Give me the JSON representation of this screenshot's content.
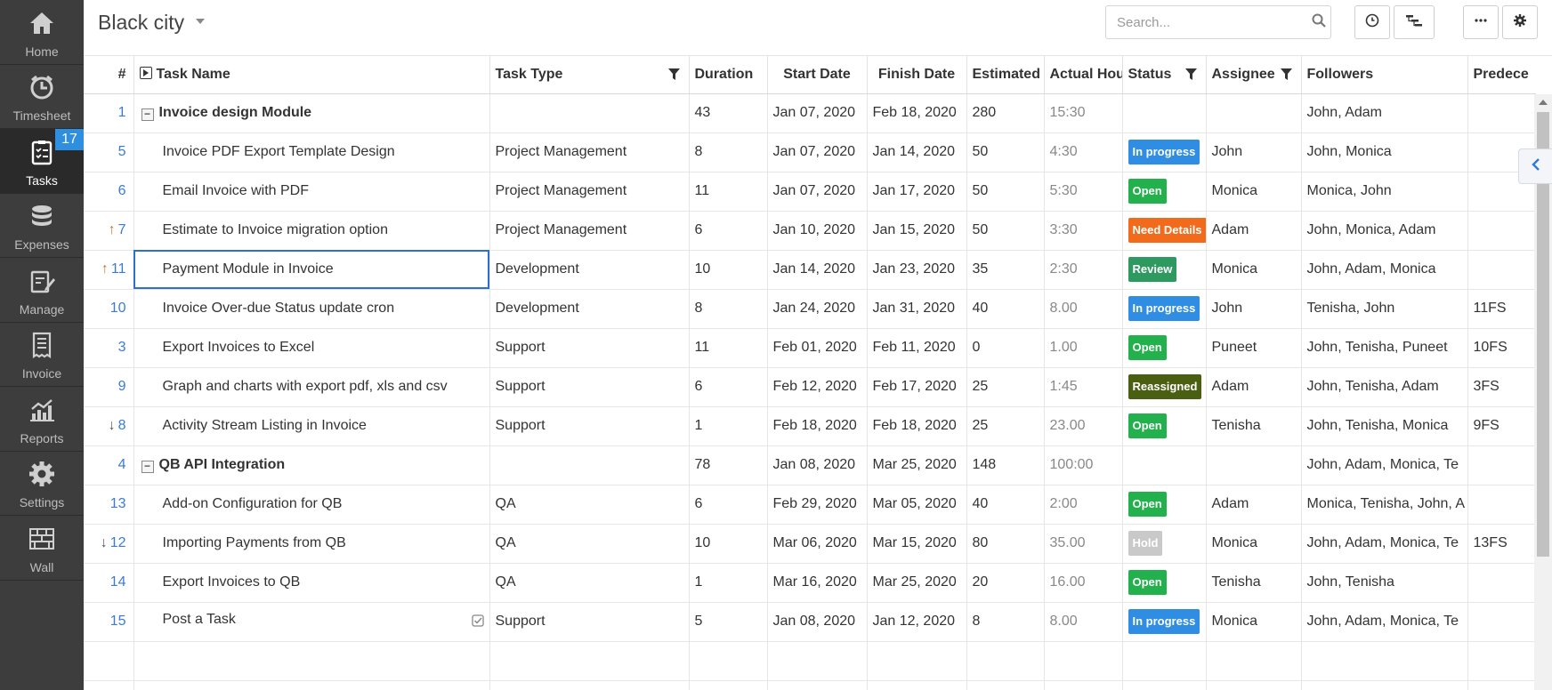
{
  "app": {
    "project_name": "Black city"
  },
  "sidebar": {
    "items": [
      {
        "label": "Home",
        "icon": "home-icon"
      },
      {
        "label": "Timesheet",
        "icon": "clock-icon"
      },
      {
        "label": "Tasks",
        "icon": "tasks-icon",
        "badge": "17",
        "active": true
      },
      {
        "label": "Expenses",
        "icon": "coins-icon"
      },
      {
        "label": "Manage",
        "icon": "manage-icon"
      },
      {
        "label": "Invoice",
        "icon": "invoice-icon"
      },
      {
        "label": "Reports",
        "icon": "chart-icon"
      },
      {
        "label": "Settings",
        "icon": "gear-icon"
      },
      {
        "label": "Wall",
        "icon": "wall-icon"
      }
    ]
  },
  "toolbar": {
    "search_placeholder": "Search...",
    "buttons": [
      "clock-icon",
      "hierarchy-icon",
      "more-icon",
      "gear-icon"
    ]
  },
  "grid": {
    "columns": [
      "#",
      "Task Name",
      "Task Type",
      "Duration",
      "Start Date",
      "Finish Date",
      "Estimated",
      "Actual Hou",
      "Status",
      "Assignee",
      "Followers",
      "Predece"
    ],
    "rows": [
      {
        "id": "1",
        "arrow": "",
        "task": "Invoice design Module",
        "group": true,
        "type": "",
        "duration": "43",
        "start": "Jan 07, 2020",
        "finish": "Feb 18, 2020",
        "estimated": "280",
        "actual": "15:30",
        "status": "",
        "assignee": "",
        "followers": "John, Adam",
        "pred": ""
      },
      {
        "id": "5",
        "arrow": "",
        "task": "Invoice PDF Export Template Design",
        "type": "Project Management",
        "duration": "8",
        "start": "Jan 07, 2020",
        "finish": "Jan 14, 2020",
        "estimated": "50",
        "actual": "4:30",
        "status": "In progress",
        "assignee": "John",
        "followers": "John, Monica",
        "pred": ""
      },
      {
        "id": "6",
        "arrow": "",
        "task": "Email Invoice with PDF",
        "type": "Project Management",
        "duration": "11",
        "start": "Jan 07, 2020",
        "finish": "Jan 17, 2020",
        "estimated": "50",
        "actual": "5:30",
        "status": "Open",
        "assignee": "Monica",
        "followers": "Monica, John",
        "pred": ""
      },
      {
        "id": "7",
        "arrow": "↑",
        "task": "Estimate to Invoice migration option",
        "type": "Project Management",
        "duration": "6",
        "start": "Jan 10, 2020",
        "finish": "Jan 15, 2020",
        "estimated": "50",
        "actual": "3:30",
        "status": "Need Details",
        "assignee": "Adam",
        "followers": "John, Monica, Adam",
        "pred": ""
      },
      {
        "id": "11",
        "arrow": "↑",
        "task": "Payment Module in Invoice",
        "selected": true,
        "type": "Development",
        "duration": "10",
        "start": "Jan 14, 2020",
        "finish": "Jan 23, 2020",
        "estimated": "35",
        "actual": "2:30",
        "status": "Review",
        "assignee": "Monica",
        "followers": "John, Adam, Monica",
        "pred": ""
      },
      {
        "id": "10",
        "arrow": "",
        "task": "Invoice Over-due Status update cron",
        "type": "Development",
        "duration": "8",
        "start": "Jan 24, 2020",
        "finish": "Jan 31, 2020",
        "estimated": "40",
        "actual": "8.00",
        "status": "In progress",
        "assignee": "John",
        "followers": "Tenisha, John",
        "pred": "11FS"
      },
      {
        "id": "3",
        "arrow": "",
        "task": "Export Invoices to Excel",
        "type": "Support",
        "duration": "11",
        "start": "Feb 01, 2020",
        "finish": "Feb 11, 2020",
        "estimated": "0",
        "actual": "1.00",
        "status": "Open",
        "assignee": "Puneet",
        "followers": "John, Tenisha, Puneet",
        "pred": "10FS"
      },
      {
        "id": "9",
        "arrow": "",
        "task": "Graph and charts with export pdf, xls and csv",
        "type": "Support",
        "duration": "6",
        "start": "Feb 12, 2020",
        "finish": "Feb 17, 2020",
        "estimated": "25",
        "actual": "1:45",
        "status": "Reassigned",
        "assignee": "Adam",
        "followers": "John, Tenisha, Adam",
        "pred": "3FS"
      },
      {
        "id": "8",
        "arrow": "↓",
        "task": "Activity Stream Listing in Invoice",
        "type": "Support",
        "duration": "1",
        "start": "Feb 18, 2020",
        "finish": "Feb 18, 2020",
        "estimated": "25",
        "actual": "23.00",
        "status": "Open",
        "assignee": "Tenisha",
        "followers": "John, Tenisha, Monica",
        "pred": "9FS"
      },
      {
        "id": "4",
        "arrow": "",
        "task": "QB API Integration",
        "group": true,
        "type": "",
        "duration": "78",
        "start": "Jan 08, 2020",
        "finish": "Mar 25, 2020",
        "estimated": "148",
        "actual": "100:00",
        "status": "",
        "assignee": "",
        "followers": "John, Adam, Monica, Te",
        "pred": ""
      },
      {
        "id": "13",
        "arrow": "",
        "task": "Add-on Configuration for QB",
        "type": "QA",
        "duration": "6",
        "start": "Feb 29, 2020",
        "finish": "Mar 05, 2020",
        "estimated": "40",
        "actual": "2:00",
        "status": "Open",
        "assignee": "Adam",
        "followers": "Monica, Tenisha, John, A",
        "pred": ""
      },
      {
        "id": "12",
        "arrow": "↓",
        "task": "Importing Payments from QB",
        "type": "QA",
        "duration": "10",
        "start": "Mar 06, 2020",
        "finish": "Mar 15, 2020",
        "estimated": "80",
        "actual": "35.00",
        "status": "Hold",
        "assignee": "Monica",
        "followers": "John, Adam, Monica, Te",
        "pred": "13FS"
      },
      {
        "id": "14",
        "arrow": "",
        "task": "Export Invoices to QB",
        "type": "QA",
        "duration": "1",
        "start": "Mar 16, 2020",
        "finish": "Mar 25, 2020",
        "estimated": "20",
        "actual": "16.00",
        "status": "Open",
        "assignee": "Tenisha",
        "followers": "John, Tenisha",
        "pred": ""
      },
      {
        "id": "15",
        "arrow": "",
        "task": "Post a Task",
        "check": true,
        "type": "Support",
        "duration": "5",
        "start": "Jan 08, 2020",
        "finish": "Jan 12, 2020",
        "estimated": "8",
        "actual": "8.00",
        "status": "In progress",
        "assignee": "Monica",
        "followers": "John, Adam, Monica, Te",
        "pred": ""
      }
    ]
  },
  "status_colors": {
    "In progress": "#2f8de4",
    "Open": "#22b14c",
    "Need Details": "#f26b1d",
    "Review": "#2e9a5f",
    "Reassigned": "#4b5f12",
    "Hold": "#c9c9c9"
  }
}
